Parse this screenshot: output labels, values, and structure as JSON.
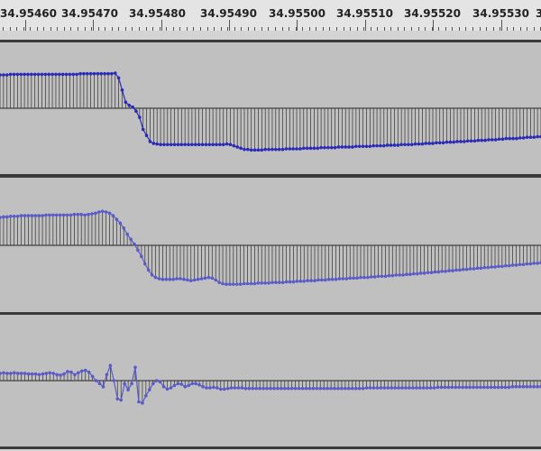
{
  "window": {
    "app": "audio waveform editor"
  },
  "ruler": {
    "start_label": "34.95460",
    "labels": [
      "34.95470",
      "34.95480",
      "34.95490",
      "34.95500",
      "34.95510",
      "34.95520",
      "34.95530",
      "3"
    ]
  },
  "tracks": [
    {
      "name": "waveform-track-1",
      "color": "#2a2ab8",
      "baseline_pct": 0.5,
      "values": [
        0.55,
        0.55,
        0.55,
        0.56,
        0.56,
        0.56,
        0.56,
        0.56,
        0.56,
        0.56,
        0.56,
        0.56,
        0.56,
        0.56,
        0.56,
        0.56,
        0.56,
        0.56,
        0.56,
        0.56,
        0.56,
        0.56,
        0.56,
        0.57,
        0.57,
        0.57,
        0.57,
        0.57,
        0.57,
        0.57,
        0.57,
        0.57,
        0.57,
        0.58,
        0.5,
        0.3,
        0.1,
        0.05,
        0.02,
        -0.05,
        -0.15,
        -0.35,
        -0.45,
        -0.55,
        -0.58,
        -0.59,
        -0.6,
        -0.6,
        -0.6,
        -0.6,
        -0.6,
        -0.6,
        -0.6,
        -0.6,
        -0.6,
        -0.6,
        -0.6,
        -0.6,
        -0.6,
        -0.6,
        -0.6,
        -0.6,
        -0.6,
        -0.6,
        -0.6,
        -0.59,
        -0.6,
        -0.62,
        -0.64,
        -0.66,
        -0.68,
        -0.68,
        -0.69,
        -0.69,
        -0.69,
        -0.69,
        -0.68,
        -0.68,
        -0.68,
        -0.68,
        -0.68,
        -0.68,
        -0.67,
        -0.67,
        -0.67,
        -0.67,
        -0.67,
        -0.66,
        -0.66,
        -0.66,
        -0.66,
        -0.66,
        -0.65,
        -0.65,
        -0.65,
        -0.65,
        -0.65,
        -0.64,
        -0.64,
        -0.64,
        -0.64,
        -0.64,
        -0.63,
        -0.63,
        -0.63,
        -0.63,
        -0.63,
        -0.62,
        -0.62,
        -0.62,
        -0.62,
        -0.61,
        -0.61,
        -0.61,
        -0.61,
        -0.6,
        -0.6,
        -0.6,
        -0.6,
        -0.59,
        -0.59,
        -0.59,
        -0.58,
        -0.58,
        -0.58,
        -0.57,
        -0.57,
        -0.57,
        -0.56,
        -0.56,
        -0.56,
        -0.55,
        -0.55,
        -0.55,
        -0.54,
        -0.54,
        -0.54,
        -0.53,
        -0.53,
        -0.53,
        -0.52,
        -0.52,
        -0.52,
        -0.51,
        -0.51,
        -0.5,
        -0.5,
        -0.5,
        -0.5,
        -0.49,
        -0.49,
        -0.48,
        -0.48,
        -0.48,
        -0.47,
        -0.47
      ]
    },
    {
      "name": "waveform-track-2",
      "color": "#5a5ac8",
      "baseline_pct": 0.5,
      "values": [
        0.45,
        0.46,
        0.46,
        0.47,
        0.47,
        0.47,
        0.48,
        0.48,
        0.48,
        0.48,
        0.48,
        0.48,
        0.48,
        0.49,
        0.49,
        0.49,
        0.49,
        0.49,
        0.49,
        0.49,
        0.49,
        0.5,
        0.5,
        0.5,
        0.49,
        0.5,
        0.51,
        0.52,
        0.54,
        0.55,
        0.54,
        0.52,
        0.48,
        0.42,
        0.36,
        0.28,
        0.18,
        0.1,
        0.02,
        -0.08,
        -0.18,
        -0.3,
        -0.4,
        -0.48,
        -0.52,
        -0.54,
        -0.55,
        -0.55,
        -0.55,
        -0.55,
        -0.54,
        -0.54,
        -0.55,
        -0.56,
        -0.57,
        -0.56,
        -0.55,
        -0.54,
        -0.53,
        -0.52,
        -0.53,
        -0.56,
        -0.6,
        -0.62,
        -0.63,
        -0.63,
        -0.63,
        -0.63,
        -0.63,
        -0.62,
        -0.62,
        -0.62,
        -0.62,
        -0.61,
        -0.61,
        -0.61,
        -0.61,
        -0.6,
        -0.6,
        -0.6,
        -0.6,
        -0.59,
        -0.59,
        -0.59,
        -0.58,
        -0.58,
        -0.58,
        -0.57,
        -0.57,
        -0.57,
        -0.56,
        -0.56,
        -0.56,
        -0.55,
        -0.55,
        -0.55,
        -0.54,
        -0.54,
        -0.54,
        -0.53,
        -0.53,
        -0.53,
        -0.52,
        -0.52,
        -0.52,
        -0.51,
        -0.51,
        -0.5,
        -0.5,
        -0.5,
        -0.49,
        -0.49,
        -0.48,
        -0.48,
        -0.48,
        -0.47,
        -0.47,
        -0.46,
        -0.46,
        -0.45,
        -0.45,
        -0.44,
        -0.44,
        -0.43,
        -0.43,
        -0.42,
        -0.42,
        -0.41,
        -0.41,
        -0.4,
        -0.4,
        -0.39,
        -0.39,
        -0.38,
        -0.38,
        -0.37,
        -0.37,
        -0.36,
        -0.36,
        -0.35,
        -0.35,
        -0.34,
        -0.34,
        -0.33,
        -0.33,
        -0.32,
        -0.32,
        -0.31,
        -0.31,
        -0.3,
        -0.3,
        -0.29,
        -0.29,
        -0.28
      ]
    },
    {
      "name": "waveform-track-3",
      "color": "#5a5ac8",
      "baseline_pct": 0.5,
      "values": [
        0.12,
        0.13,
        0.12,
        0.12,
        0.13,
        0.12,
        0.12,
        0.12,
        0.11,
        0.11,
        0.11,
        0.1,
        0.11,
        0.12,
        0.13,
        0.12,
        0.1,
        0.09,
        0.11,
        0.15,
        0.14,
        0.1,
        0.13,
        0.16,
        0.17,
        0.14,
        0.07,
        0.0,
        -0.05,
        -0.1,
        0.1,
        0.25,
        0.0,
        -0.3,
        -0.32,
        -0.05,
        -0.15,
        -0.05,
        0.22,
        -0.35,
        -0.37,
        -0.25,
        -0.15,
        -0.05,
        0.0,
        -0.02,
        -0.1,
        -0.14,
        -0.12,
        -0.08,
        -0.05,
        -0.06,
        -0.1,
        -0.08,
        -0.05,
        -0.05,
        -0.07,
        -0.1,
        -0.12,
        -0.12,
        -0.11,
        -0.12,
        -0.14,
        -0.14,
        -0.13,
        -0.12,
        -0.12,
        -0.12,
        -0.12,
        -0.13,
        -0.13,
        -0.13,
        -0.13,
        -0.13,
        -0.13,
        -0.13,
        -0.13,
        -0.13,
        -0.13,
        -0.13,
        -0.13,
        -0.13,
        -0.13,
        -0.13,
        -0.13,
        -0.13,
        -0.13,
        -0.13,
        -0.13,
        -0.13,
        -0.13,
        -0.13,
        -0.13,
        -0.13,
        -0.13,
        -0.13,
        -0.13,
        -0.13,
        -0.13,
        -0.13,
        -0.13,
        -0.13,
        -0.13,
        -0.12,
        -0.12,
        -0.12,
        -0.12,
        -0.12,
        -0.12,
        -0.12,
        -0.12,
        -0.12,
        -0.12,
        -0.12,
        -0.12,
        -0.12,
        -0.12,
        -0.12,
        -0.12,
        -0.12,
        -0.12,
        -0.12,
        -0.12,
        -0.11,
        -0.11,
        -0.11,
        -0.11,
        -0.11,
        -0.11,
        -0.11,
        -0.11,
        -0.11,
        -0.11,
        -0.11,
        -0.11,
        -0.11,
        -0.11,
        -0.11,
        -0.11,
        -0.11,
        -0.11,
        -0.11,
        -0.11,
        -0.11,
        -0.1,
        -0.1,
        -0.1,
        -0.1,
        -0.1,
        -0.1,
        -0.1,
        -0.1,
        -0.1
      ]
    }
  ]
}
